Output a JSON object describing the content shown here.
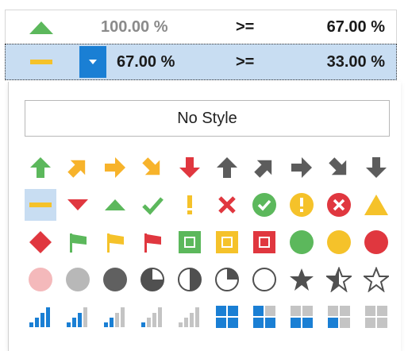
{
  "rows": [
    {
      "icon": "green-triangle-up-icon",
      "value1": "100.00 %",
      "operator": ">=",
      "value2": "67.00 %"
    },
    {
      "icon": "yellow-dash-icon",
      "value1": "67.00 %",
      "operator": ">=",
      "value2": "33.00 %"
    }
  ],
  "dropdown": {
    "button_icon": "chevron-down-icon",
    "no_style_label": "No Style"
  },
  "icon_sets": [
    [
      "arrow-up-green-icon",
      "arrow-up-right-orange-icon",
      "arrow-right-orange-icon",
      "arrow-down-right-orange-icon",
      "arrow-down-red-icon",
      "arrow-up-gray-icon",
      "arrow-up-right-gray-icon",
      "arrow-right-gray-icon",
      "arrow-down-right-gray-icon",
      "arrow-down-gray-icon"
    ],
    [
      "dash-yellow-icon",
      "triangle-down-red-icon",
      "triangle-up-green-icon",
      "check-green-icon",
      "exclamation-yellow-icon",
      "cross-red-icon",
      "circle-check-green-icon",
      "circle-exclamation-yellow-icon",
      "circle-cross-red-icon",
      "triangle-yellow-icon"
    ],
    [
      "diamond-red-icon",
      "flag-green-icon",
      "flag-yellow-icon",
      "flag-red-icon",
      "square-green-icon",
      "square-yellow-icon",
      "square-red-icon",
      "circle-green-icon",
      "circle-yellow-icon",
      "circle-red-icon"
    ],
    [
      "circle-pink-icon",
      "circle-light-gray-icon",
      "circle-dark-gray-icon",
      "pie-three-quarter-icon",
      "pie-half-icon",
      "pie-quarter-icon",
      "circle-empty-icon",
      "star-full-icon",
      "star-half-icon",
      "star-empty-icon"
    ],
    [
      "signal-4-icon",
      "signal-3-icon",
      "signal-2-icon",
      "signal-1-icon",
      "signal-0-icon",
      "boxes-4-icon",
      "boxes-3-icon",
      "boxes-2-icon",
      "boxes-1-icon",
      "boxes-0-icon"
    ]
  ],
  "colors": {
    "green": "#5cb85c",
    "orange": "#f7b32b",
    "red": "#e0373f",
    "gray": "#5c5c5c",
    "yellow": "#f5c22a",
    "blue": "#1a7fd4",
    "selection": "#c8ddf2"
  }
}
